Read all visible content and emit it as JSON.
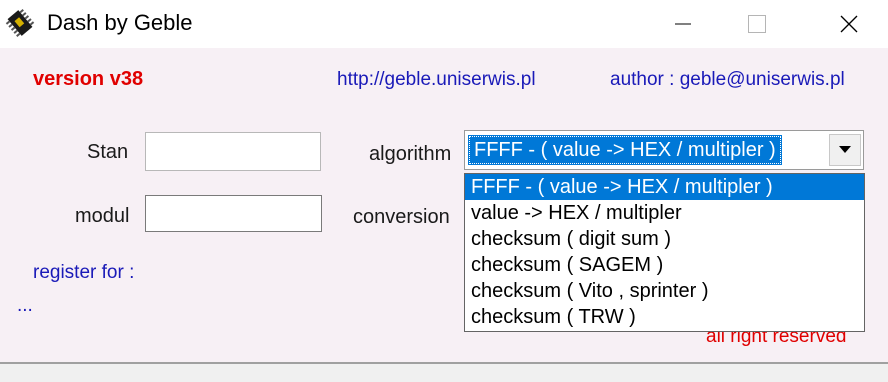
{
  "window": {
    "title": "Dash by Geble",
    "icon": "chip-icon"
  },
  "header": {
    "version": "version v38",
    "url": "http://geble.uniserwis.pl",
    "author": "author : geble@uniserwis.pl"
  },
  "form": {
    "stan_label": "Stan",
    "stan_value": "",
    "modul_label": "modul",
    "modul_value": "",
    "algorithm_label": "algorithm",
    "algorithm_value": "FFFF - ( value -> HEX / multipler )",
    "conversion_label": "conversion"
  },
  "dropdown": {
    "options": [
      "FFFF - ( value -> HEX / multipler )",
      "value -> HEX / multipler",
      "checksum ( digit sum )",
      "checksum ( SAGEM )",
      "checksum ( Vito , sprinter )",
      "checksum ( TRW )"
    ],
    "selected_index": 0
  },
  "footer": {
    "register": "register for :",
    "dots": "...",
    "rights": "all right reserved"
  },
  "colors": {
    "accent": "#0078d7",
    "red_text": "#e00000",
    "blue_text": "#1a1ab8",
    "background": "#f7f0f5"
  }
}
